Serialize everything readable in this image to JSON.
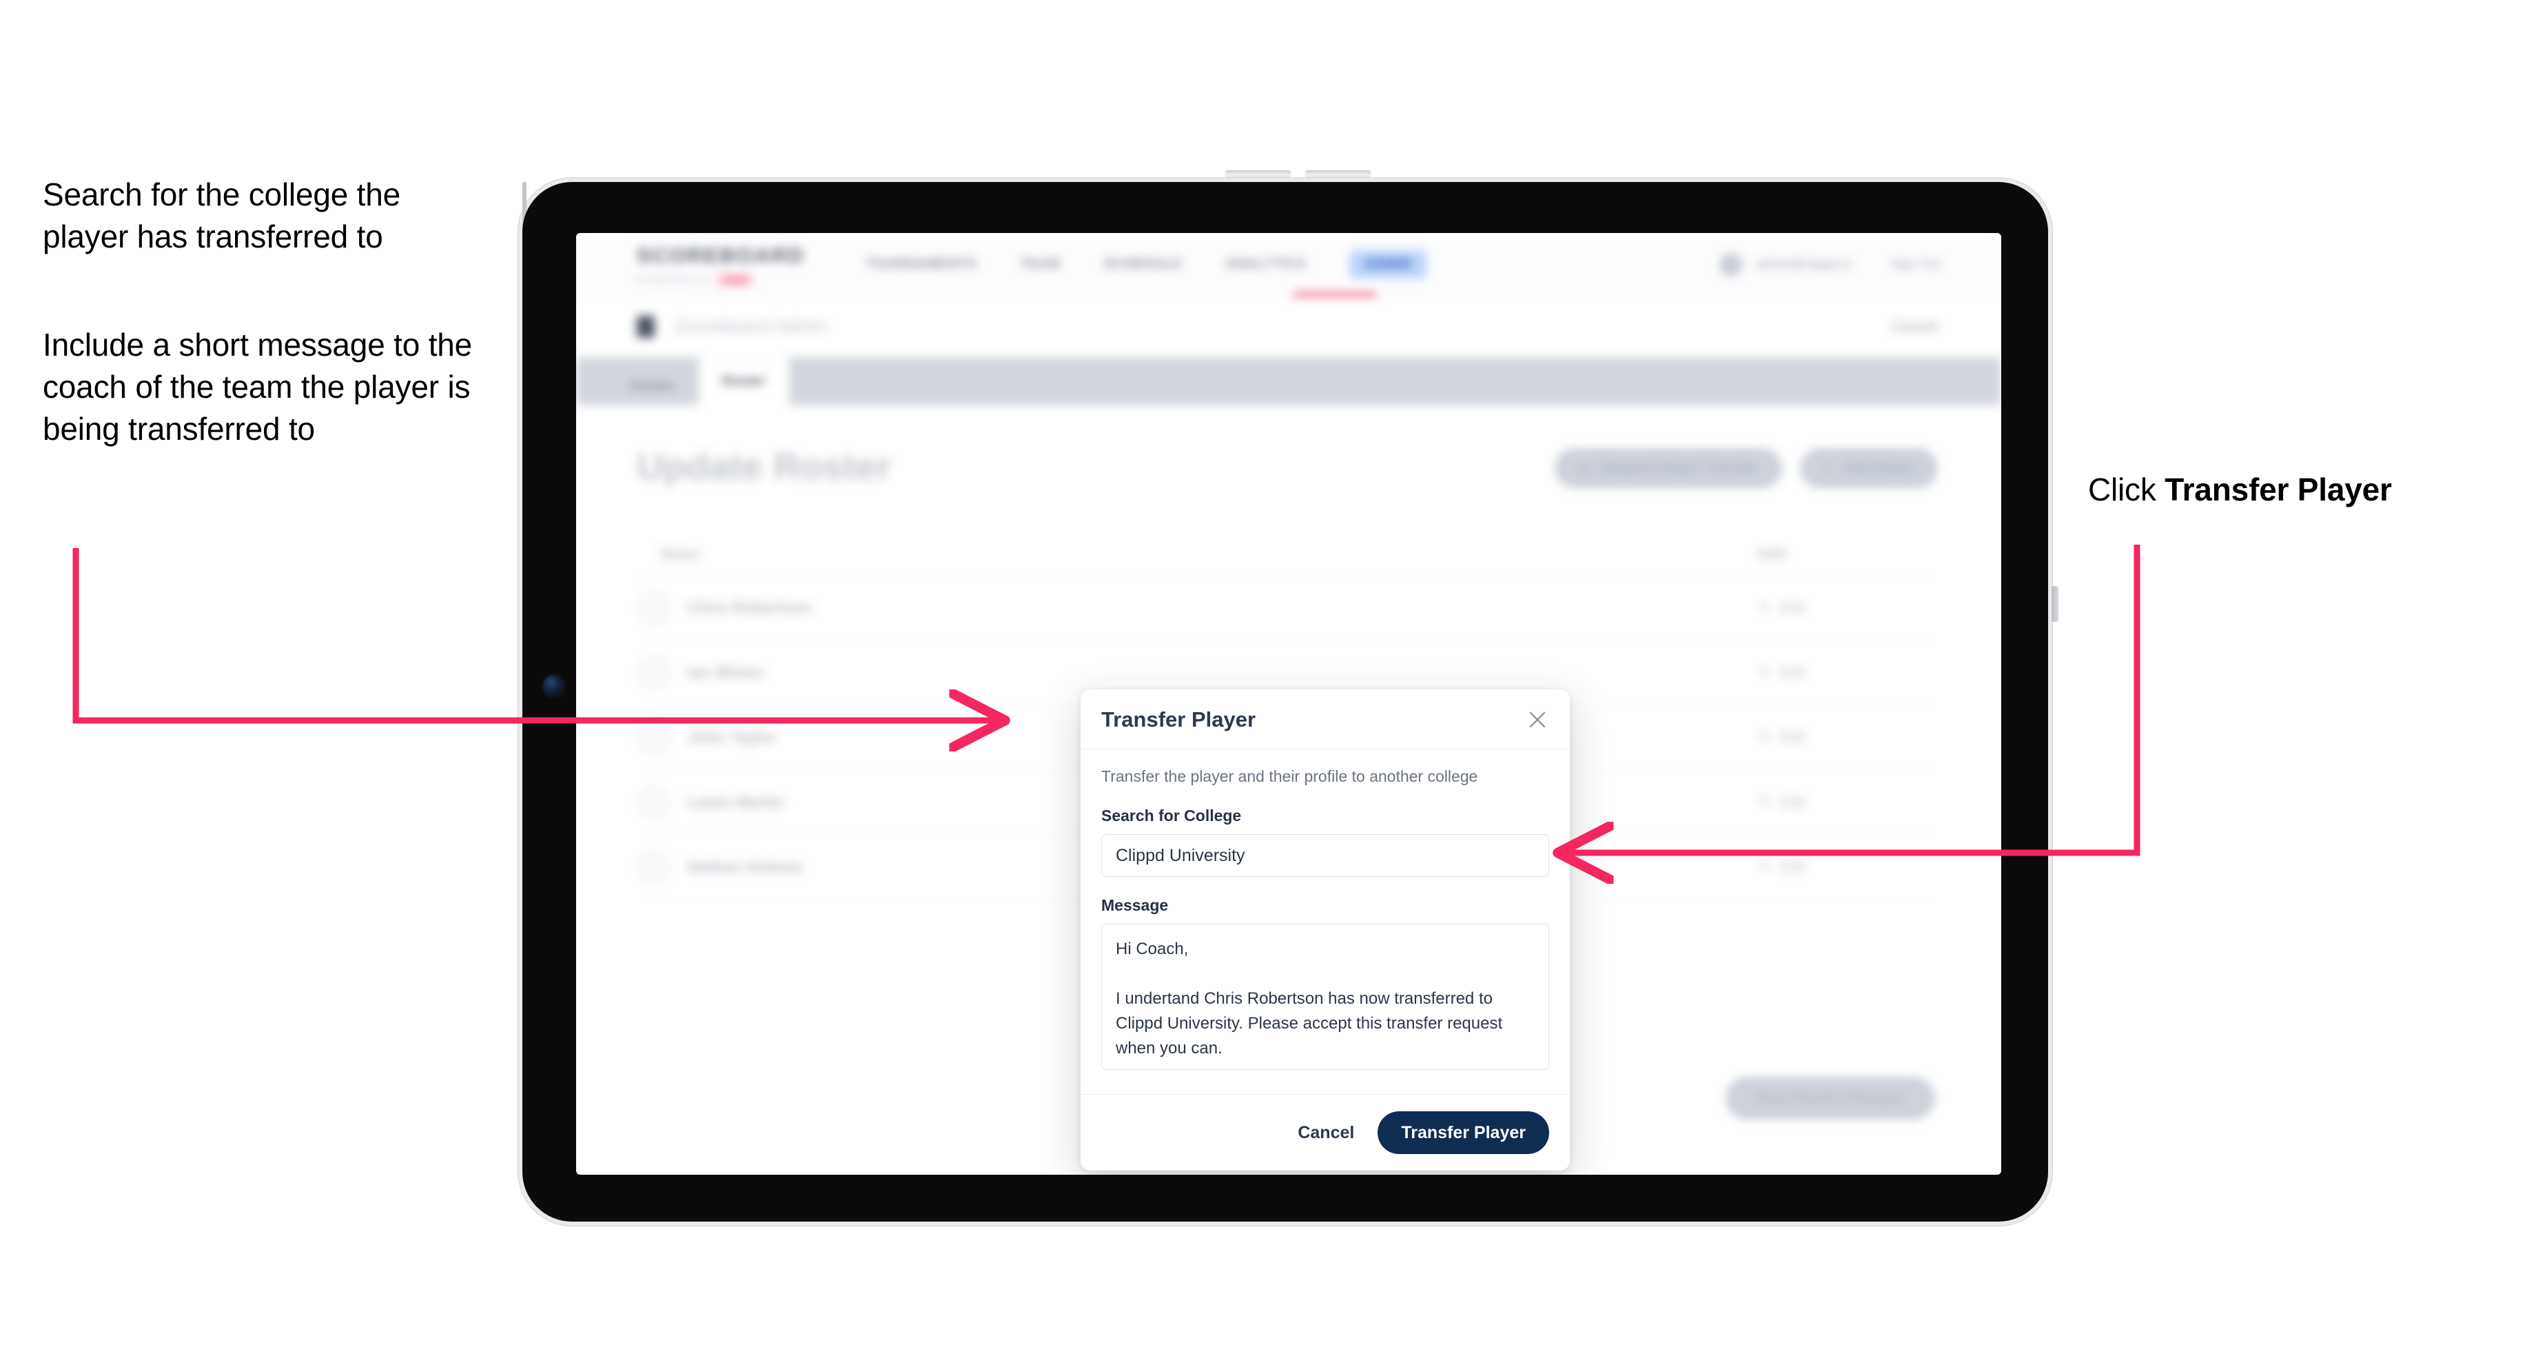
{
  "annotations": {
    "left_top": "Search for the college the player has transferred to",
    "left_bottom": "Include a short message to the coach of the team the player is being transferred to",
    "right_prefix": "Click ",
    "right_emphasis": "Transfer Player"
  },
  "colors": {
    "arrow": "#f4275e",
    "primary_button": "#0e2d52",
    "brand_accent": "#f4275e"
  },
  "app": {
    "brand": {
      "word": "SCOREBOARD",
      "subtitle": "POWERED BY",
      "badge": "clippd"
    },
    "nav_links": [
      {
        "label": "TOURNAMENTS"
      },
      {
        "label": "TEAM"
      },
      {
        "label": "SCHEDULE"
      },
      {
        "label": "ANALYTICS"
      },
      {
        "label": "ADMIN"
      }
    ],
    "nav_user": "admin@clippd.io",
    "nav_signout": "Sign Out",
    "breadcrumb": {
      "text": "Scoreboard",
      "muted": " Admin"
    },
    "breadcrumb_action": "Cancel",
    "tabs": [
      {
        "label": "Details",
        "active": false
      },
      {
        "label": "Roster",
        "active": true
      }
    ],
    "page_title": "Update Roster",
    "roster_actions": [
      {
        "label": "Request Player Transfer",
        "icon": "transfer-icon"
      },
      {
        "label": "Add Player",
        "icon": "plus-icon"
      }
    ],
    "table": {
      "columns": [
        "Name",
        "Edit"
      ],
      "rows": [
        {
          "name": "Chris Robertson",
          "action": "Edit"
        },
        {
          "name": "Ian Winter",
          "action": "Edit"
        },
        {
          "name": "John Taylor",
          "action": "Edit"
        },
        {
          "name": "Lewis Martin",
          "action": "Edit"
        },
        {
          "name": "Nathan Holmes",
          "action": "Edit"
        }
      ]
    },
    "save_button": "Save Roster Changes"
  },
  "modal": {
    "title": "Transfer Player",
    "close_icon": "close-icon",
    "subtitle": "Transfer the player and their profile to another college",
    "search_label": "Search for College",
    "search_value": "Clippd University",
    "search_placeholder": "Search for College",
    "message_label": "Message",
    "message_value": "Hi Coach,\n\nI undertand Chris Robertson has now transferred to Clippd University. Please accept this transfer request when you can.",
    "message_placeholder": "Message",
    "cancel_label": "Cancel",
    "submit_label": "Transfer Player"
  }
}
